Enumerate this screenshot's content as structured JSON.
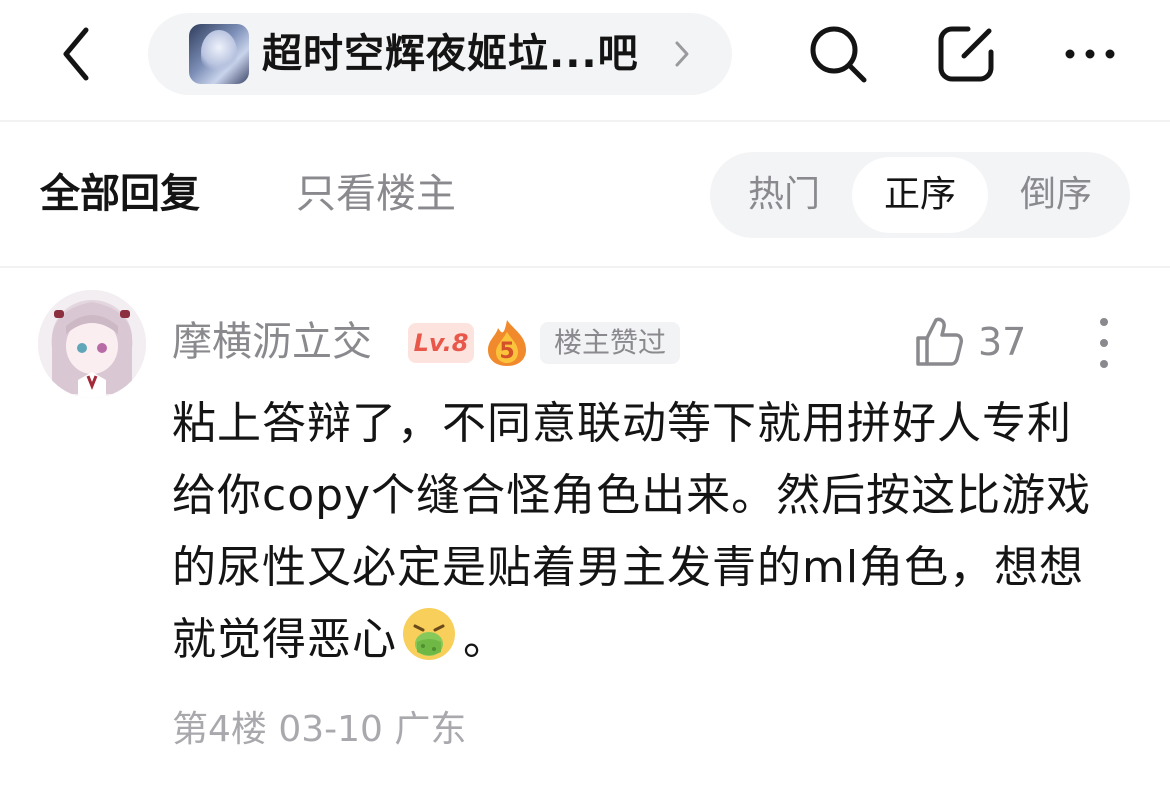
{
  "header": {
    "forum_name": "超时空辉夜姬垃...吧",
    "icons": {
      "back": "back-chevron-icon",
      "forward": "chevron-right-icon",
      "search": "search-icon",
      "edit": "edit-icon",
      "more": "more-horizontal-icon"
    }
  },
  "tabs": {
    "all_replies": "全部回复",
    "op_only": "只看楼主"
  },
  "sort": {
    "options": [
      "热门",
      "正序",
      "倒序"
    ],
    "selected": "正序"
  },
  "comment": {
    "username": "摩横沥立交",
    "level": "Lv.8",
    "badge_number": "5",
    "op_liked": "楼主赞过",
    "like_count": "37",
    "text_before_emoji": "粘上答辩了，不同意联动等下就用拼好人专利给你copy个缝合怪角色出来。然后按这比游戏的尿性又必定是贴着男主发青的ml角色，想想就觉得恶心",
    "emoji": "vomit-emoji",
    "text_after_emoji": "。",
    "meta": "第4楼 03-10 广东"
  },
  "colors": {
    "text_primary": "#141414",
    "text_secondary": "#8a8a8e",
    "text_meta": "#a9a9ad",
    "pill_bg": "#f3f4f6",
    "level_badge_bg": "#fde3dd",
    "level_badge_text": "#e8574a"
  }
}
